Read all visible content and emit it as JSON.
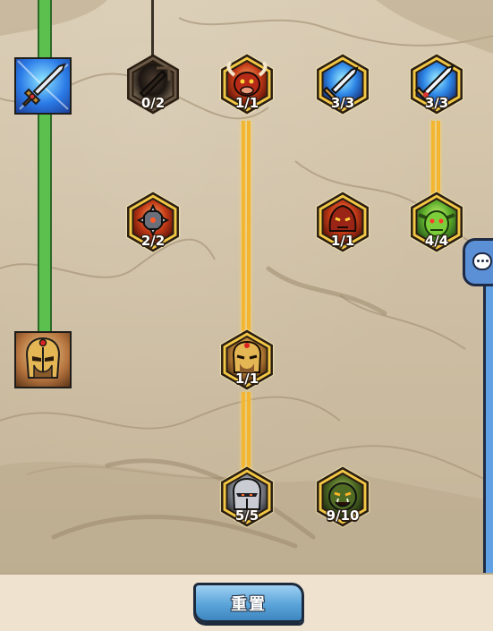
{
  "track": {
    "progress": 1.0
  },
  "square_icons": [
    {
      "id": "sword",
      "icon": "sword-icon"
    },
    {
      "id": "gladiator",
      "icon": "gladiator-helmet-icon"
    }
  ],
  "nodes": [
    {
      "icon": "shadow-blade-icon",
      "count": "0/2",
      "theme": "locked"
    },
    {
      "icon": "fire-ox-icon",
      "count": "1/1",
      "theme": "red"
    },
    {
      "icon": "dagger-icon",
      "count": "3/3",
      "theme": "blue"
    },
    {
      "icon": "enchanted-sword-icon",
      "count": "3/3",
      "theme": "blue"
    },
    {
      "icon": "spiked-mace-icon",
      "count": "2/2",
      "theme": "red"
    },
    {
      "icon": "fire-demon-icon",
      "count": "1/1",
      "theme": "red"
    },
    {
      "icon": "goblin-icon",
      "count": "4/4",
      "theme": "green"
    },
    {
      "icon": "gladiator-helmet-icon",
      "count": "1/1",
      "theme": "gold"
    },
    {
      "icon": "knight-helmet-icon",
      "count": "5/5",
      "theme": "steel"
    },
    {
      "icon": "orc-icon",
      "count": "9/10",
      "theme": "orc"
    }
  ],
  "chat": {
    "icon": "chat-bubble-icon"
  },
  "reset_button": {
    "label": "重置"
  },
  "colors": {
    "link": "#f3b530",
    "frame": "#f2c744",
    "track": "#5cc04f",
    "button": "#5aa4d9"
  }
}
